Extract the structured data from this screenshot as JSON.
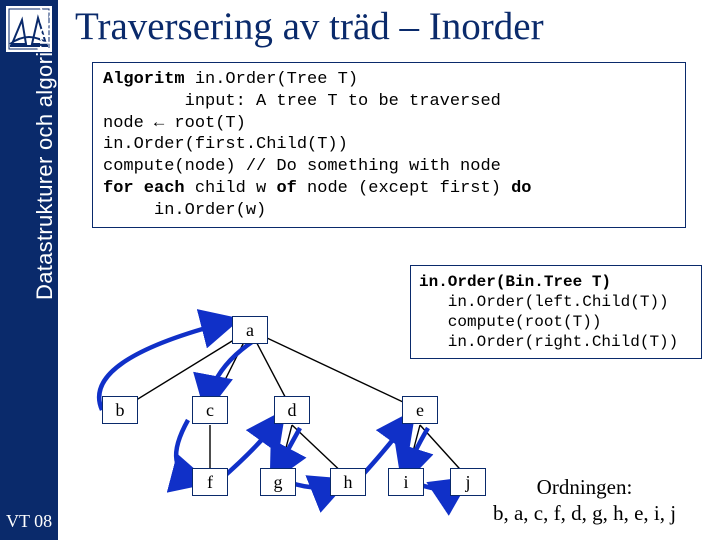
{
  "sidebar": {
    "course_label": "Datastrukturer och algoritmer",
    "footer": "VT 08"
  },
  "title": "Traversering av träd – Inorder",
  "algorithm": {
    "line1_a": "Algoritm",
    "line1_b": " in.Order(Tree T)",
    "line2": "        input: A tree T to be traversed",
    "line3": "node ← root(T)",
    "line4": "in.Order(first.Child(T))",
    "line5": "compute(node) // Do something with node",
    "line6_a": "for each",
    "line6_b": " child w ",
    "line6_c": "of",
    "line6_d": " node (except first) ",
    "line6_e": "do",
    "line7": "     in.Order(w)"
  },
  "binary_algo": {
    "line1_a": "in.Order(Bin.Tree T)",
    "line2": "   in.Order(left.Child(T))",
    "line3": "   compute(root(T))",
    "line4": "   in.Order(right.Child(T))"
  },
  "tree": {
    "a": "a",
    "b": "b",
    "c": "c",
    "d": "d",
    "e": "e",
    "f": "f",
    "g": "g",
    "h": "h",
    "i": "i",
    "j": "j"
  },
  "ordering": {
    "label": "Ordningen:",
    "sequence": "b, a, c, f, d, g, h, e, i, j"
  }
}
